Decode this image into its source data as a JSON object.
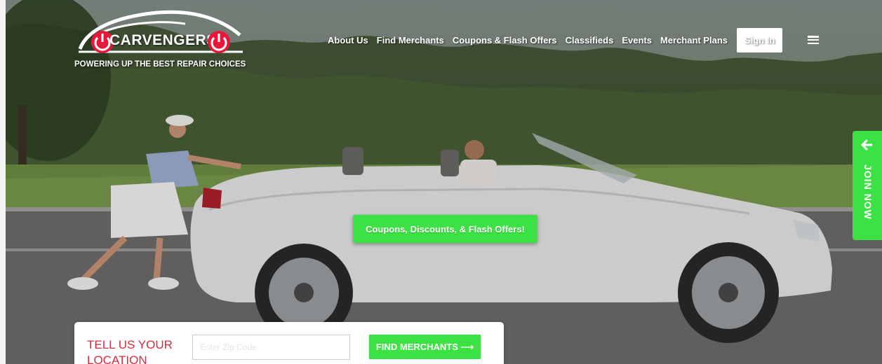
{
  "logo": {
    "brand": "CARVENGERS",
    "tagline": "POWERING UP THE BEST REPAIR CHOICES",
    "colors": {
      "accent": "#e8173a",
      "text": "#ffffff"
    }
  },
  "nav": {
    "items": [
      {
        "label": "About Us"
      },
      {
        "label": "Find Merchants"
      },
      {
        "label": "Coupons & Flash Offers"
      },
      {
        "label": "Classifieds"
      },
      {
        "label": "Events"
      },
      {
        "label": "Merchant Plans"
      }
    ],
    "sign_in": "Sign In",
    "menu_icon": "hamburger-icon"
  },
  "hero": {
    "cta_label": "Coupons, Discounts, & Flash Offers!"
  },
  "join_tab": {
    "label": "JOIN NOW",
    "icon": "arrow-left-icon"
  },
  "location": {
    "title": "TELL US YOUR LOCATION",
    "input_placeholder": "Enter Zip Code",
    "button_label": "FIND MERCHANTS ⟶"
  },
  "colors": {
    "green": "#3ce244",
    "red": "#e8173a"
  }
}
